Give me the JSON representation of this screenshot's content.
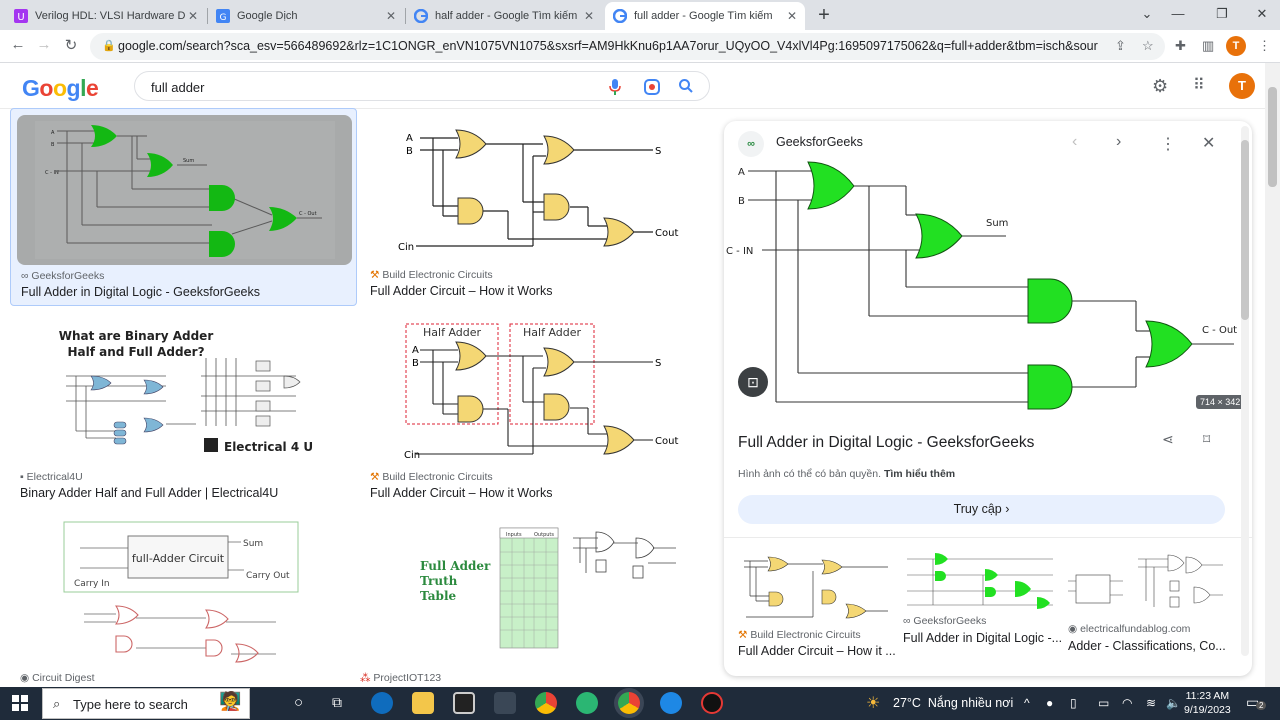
{
  "tabs": [
    {
      "label": "Verilog HDL: VLSI Hardware Des",
      "active": false
    },
    {
      "label": "Google Dịch",
      "active": false
    },
    {
      "label": "half adder - Google Tìm kiếm",
      "active": false
    },
    {
      "label": "full adder - Google Tìm kiếm",
      "active": true
    }
  ],
  "browser": {
    "url": "google.com/search?sca_esv=566489692&rlz=1C1ONGR_enVN1075VN1075&sxsrf=AM9HkKnu6p1AA7orur_UQyOO_V4xlVl4Pg:1695097175062&q=full+adder&tbm=isch&source=lnms&sa=...",
    "profile_initial": "T"
  },
  "google": {
    "logo": "Google",
    "query": "full adder",
    "avatar_initial": "T"
  },
  "results": [
    {
      "source": "GeeksforGeeks",
      "title": "Full Adder in Digital Logic - GeeksforGeeks"
    },
    {
      "source": "Build Electronic Circuits",
      "title": "Full Adder Circuit – How it Works"
    },
    {
      "source": "Electrical4U",
      "title": "Binary Adder Half and Full Adder | Electrical4U"
    },
    {
      "source": "Build Electronic Circuits",
      "title": "Full Adder Circuit – How it Works"
    },
    {
      "source": "Circuit Digest",
      "title": ""
    },
    {
      "source": "ProjectIOT123",
      "title": ""
    }
  ],
  "thumb_text": {
    "sum": "Sum",
    "cout": "C - Out",
    "cin": "C - IN",
    "a": "A",
    "b": "B",
    "s": "S",
    "cin2": "Cin",
    "cout2": "Cout",
    "binary_title_1": "What are Binary Adder",
    "binary_title_2": "Half and Full Adder?",
    "e4u": "Electrical 4 U",
    "half_adder": "Half Adder",
    "full_adder_circuit": "full-Adder Circuit",
    "carry_in": "Carry In",
    "carry_out": "Carry Out",
    "tt_1": "Full Adder",
    "tt_2": "Truth",
    "tt_3": "Table",
    "inputs": "Inputs",
    "outputs": "Outputs"
  },
  "preview": {
    "site": "GeeksforGeeks",
    "title": "Full Adder in Digital Logic - GeeksforGeeks",
    "copyright_note": "Hình ảnh có thể có bản quyền.",
    "learn_more": "Tìm hiểu thêm",
    "visit_label": "Truy cập",
    "dimensions": "714 × 342",
    "diagram": {
      "a": "A",
      "b": "B",
      "cin": "C - IN",
      "sum": "Sum",
      "cout": "C - Out"
    }
  },
  "related": [
    {
      "source": "Build Electronic Circuits",
      "title": "Full Adder Circuit – How it ..."
    },
    {
      "source": "GeeksforGeeks",
      "title": "Full Adder in Digital Logic -..."
    },
    {
      "source": "electricalfundablog.com",
      "title": "Adder - Classifications, Co..."
    }
  ],
  "taskbar": {
    "search_placeholder": "Type here to search",
    "temperature": "27°C",
    "weather": "Nắng nhiều nơi",
    "time": "11:23 AM",
    "date": "9/19/2023",
    "notif_count": "2"
  },
  "colors": {
    "gate_green": "#22e022",
    "gate_yellow": "#f4d774",
    "google_blue": "#4285f4",
    "accent_orange": "#e8710a"
  }
}
